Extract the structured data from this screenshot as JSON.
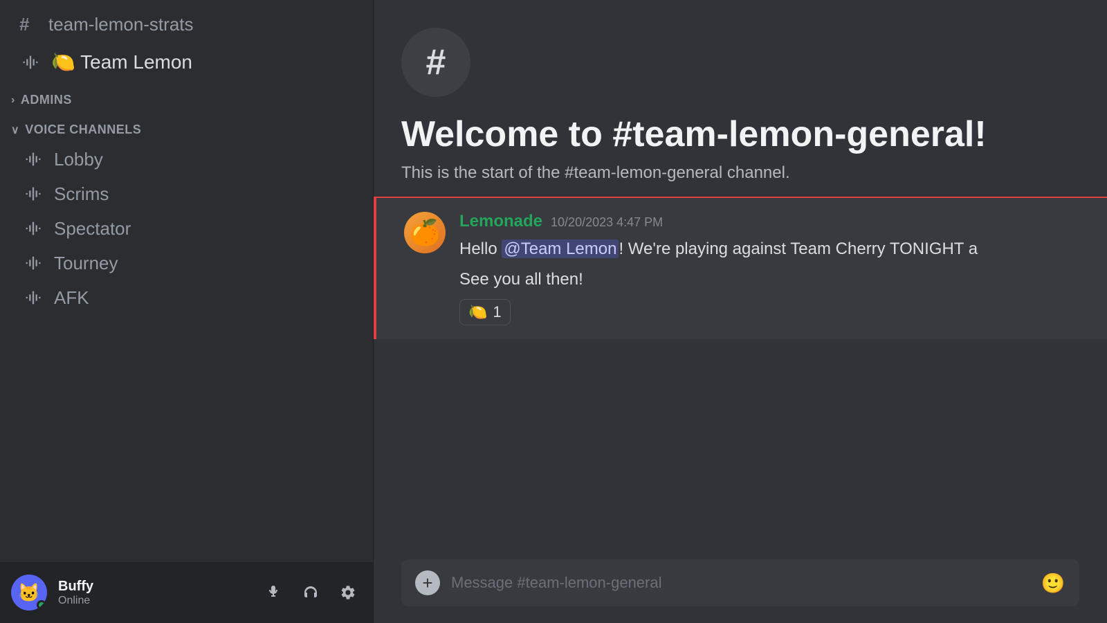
{
  "sidebar": {
    "channels": [
      {
        "id": "strats",
        "type": "text",
        "name": "team-lemon-strats"
      },
      {
        "id": "team-lemon-voice",
        "type": "voice",
        "name": "Team Lemon",
        "emoji": "🍋"
      }
    ],
    "sections": [
      {
        "id": "admins",
        "label": "ADMINS",
        "collapsed": true
      },
      {
        "id": "voice-channels",
        "label": "VOICE CHANNELS",
        "collapsed": false,
        "channels": [
          {
            "id": "lobby",
            "name": "Lobby"
          },
          {
            "id": "scrims",
            "name": "Scrims"
          },
          {
            "id": "spectator",
            "name": "Spectator"
          },
          {
            "id": "tourney",
            "name": "Tourney"
          },
          {
            "id": "afk",
            "name": "AFK"
          }
        ]
      }
    ],
    "user": {
      "name": "Buffy",
      "status": "Online",
      "avatar_emoji": "🐱"
    }
  },
  "main": {
    "channel_name": "team-lemon-general",
    "welcome_title": "Welcome to #team-lemon-general!",
    "welcome_subtitle": "This is the start of the #team-lemon-general channel.",
    "messages": [
      {
        "id": "msg1",
        "author": "Lemonade",
        "author_color": "#23a55a",
        "timestamp": "10/20/2023 4:47 PM",
        "avatar_emoji": "🍊",
        "lines": [
          "Hello @Team Lemon! We're playing against Team Cherry TONIGHT a",
          "See you all then!"
        ],
        "mention": "@Team Lemon",
        "reaction": {
          "emoji": "🍋",
          "count": "1"
        }
      }
    ],
    "input_placeholder": "Message #team-lemon-general"
  },
  "icons": {
    "hash": "#",
    "voice": "🔊",
    "mic": "🎤",
    "headphones": "🎧",
    "settings": "⚙"
  }
}
